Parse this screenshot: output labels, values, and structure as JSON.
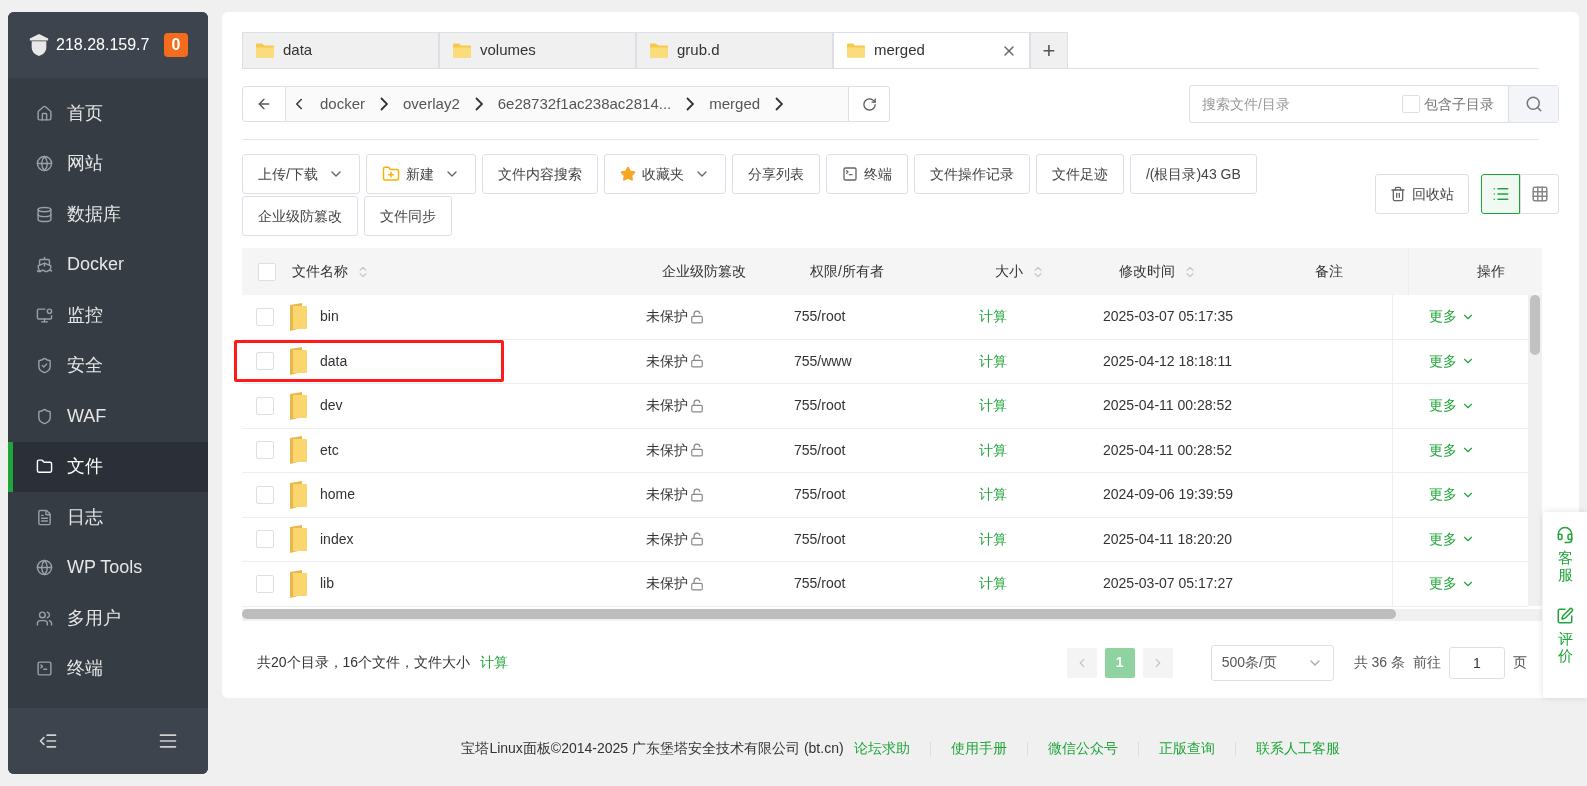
{
  "sidebar": {
    "server": "218.28.159.7",
    "badge": "0",
    "items": [
      {
        "label": "首页",
        "selected": false
      },
      {
        "label": "网站",
        "selected": false
      },
      {
        "label": "数据库",
        "selected": false
      },
      {
        "label": "Docker",
        "selected": false
      },
      {
        "label": "监控",
        "selected": false
      },
      {
        "label": "安全",
        "selected": false
      },
      {
        "label": "WAF",
        "selected": false
      },
      {
        "label": "文件",
        "selected": true
      },
      {
        "label": "日志",
        "selected": false
      },
      {
        "label": "WP Tools",
        "selected": false
      },
      {
        "label": "多用户",
        "selected": false
      },
      {
        "label": "终端",
        "selected": false
      }
    ]
  },
  "tabs": [
    {
      "label": "data",
      "selected": false
    },
    {
      "label": "volumes",
      "selected": false
    },
    {
      "label": "grub.d",
      "selected": false
    },
    {
      "label": "merged",
      "selected": true
    }
  ],
  "tab_add": "+",
  "breadcrumb": [
    "docker",
    "overlay2",
    "6e28732f1ac238ac2814...",
    "merged"
  ],
  "search": {
    "placeholder": "搜索文件/目录",
    "subdir_label": "包含子目录",
    "subdir_checked": false
  },
  "toolbar": [
    {
      "label": "上传/下载",
      "dropdown": true
    },
    {
      "label": "新建",
      "dropdown": true
    },
    {
      "label": "文件内容搜索",
      "dropdown": false
    },
    {
      "label": "收藏夹",
      "dropdown": true
    },
    {
      "label": "分享列表",
      "dropdown": false
    },
    {
      "label": "终端",
      "dropdown": false
    },
    {
      "label": "文件操作记录",
      "dropdown": false
    },
    {
      "label": "文件足迹",
      "dropdown": false
    },
    {
      "label": "/(根目录)43 GB",
      "dropdown": false
    },
    {
      "label": "企业级防篡改",
      "dropdown": false
    },
    {
      "label": "文件同步",
      "dropdown": false
    }
  ],
  "recycle_bin": "回收站",
  "views": [
    {
      "kind": "list",
      "selected": true
    },
    {
      "kind": "grid",
      "selected": false
    }
  ],
  "table": {
    "columns": [
      {
        "label": "文件名称",
        "sortable": true
      },
      {
        "label": "企业级防篡改",
        "sortable": false
      },
      {
        "label": "权限/所有者",
        "sortable": false
      },
      {
        "label": "大小",
        "sortable": true
      },
      {
        "label": "修改时间",
        "sortable": true
      },
      {
        "label": "备注",
        "sortable": false
      },
      {
        "label": "操作",
        "sortable": false
      }
    ],
    "select_all_checked": false,
    "rows": [
      {
        "name": "bin",
        "protection": "未保护",
        "owner": "755/root",
        "size": "计算",
        "modified": "2025-03-07 05:17:35",
        "action": "更多",
        "checked": false,
        "highlighted": false
      },
      {
        "name": "data",
        "protection": "未保护",
        "owner": "755/www",
        "size": "计算",
        "modified": "2025-04-12 18:18:11",
        "action": "更多",
        "checked": false,
        "highlighted": true
      },
      {
        "name": "dev",
        "protection": "未保护",
        "owner": "755/root",
        "size": "计算",
        "modified": "2025-04-11 00:28:52",
        "action": "更多",
        "checked": false,
        "highlighted": false
      },
      {
        "name": "etc",
        "protection": "未保护",
        "owner": "755/root",
        "size": "计算",
        "modified": "2025-04-11 00:28:52",
        "action": "更多",
        "checked": false,
        "highlighted": false
      },
      {
        "name": "home",
        "protection": "未保护",
        "owner": "755/root",
        "size": "计算",
        "modified": "2024-09-06 19:39:59",
        "action": "更多",
        "checked": false,
        "highlighted": false
      },
      {
        "name": "index",
        "protection": "未保护",
        "owner": "755/root",
        "size": "计算",
        "modified": "2025-04-11 18:20:20",
        "action": "更多",
        "checked": false,
        "highlighted": false
      },
      {
        "name": "lib",
        "protection": "未保护",
        "owner": "755/root",
        "size": "计算",
        "modified": "2025-03-07 05:17:27",
        "action": "更多",
        "checked": false,
        "highlighted": false
      }
    ]
  },
  "summary": {
    "text": "共20个目录，16个文件，文件大小",
    "link": "计算"
  },
  "pagination": {
    "pages": [
      {
        "label": "1",
        "selected": true
      }
    ],
    "page_size": "500条/页",
    "total": "共 36 条",
    "goto_label": "前往",
    "goto_value": "1",
    "page_suffix": "页"
  },
  "float_panel": [
    {
      "label": "客服"
    },
    {
      "label": "评价"
    }
  ],
  "footer": {
    "copyright": "宝塔Linux面板©2014-2025 广东堡塔安全技术有限公司 (bt.cn)",
    "links": [
      "论坛求助",
      "使用手册",
      "微信公众号",
      "正版查询",
      "联系人工客服"
    ]
  }
}
